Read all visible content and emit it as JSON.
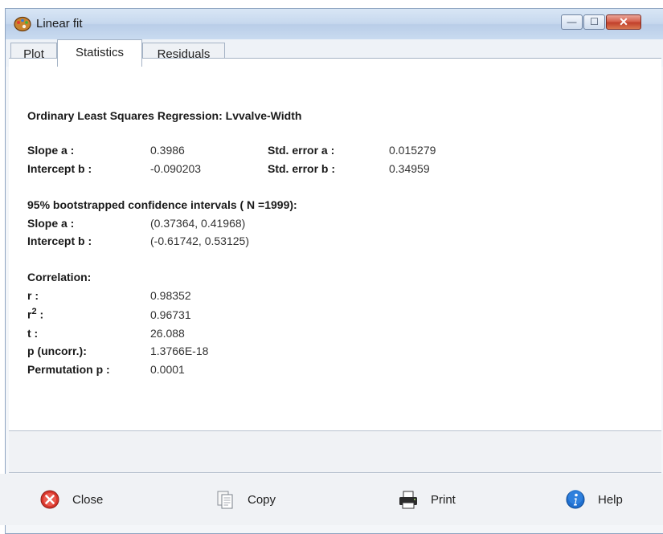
{
  "window": {
    "title": "Linear fit",
    "min_glyph": "—",
    "max_glyph": "☐",
    "close_glyph": "✕"
  },
  "tabs": [
    {
      "label": "Plot"
    },
    {
      "label": "Statistics"
    },
    {
      "label": "Residuals"
    }
  ],
  "stats": {
    "heading": "Ordinary  Least  Squares  Regression:  Lvvalve-Width",
    "slope_label": "Slope  a :",
    "slope_value": "0.3986",
    "se_a_label": "Std.  error  a :",
    "se_a_value": "0.015279",
    "intercept_label": "Intercept  b :",
    "intercept_value": "-0.090203",
    "se_b_label": "Std.  error  b :",
    "se_b_value": "0.34959",
    "ci_heading": "95%  bootstrapped  confidence  intervals  ( N =1999):",
    "ci_slope_label": "Slope  a :",
    "ci_slope_value": "(0.37364,  0.41968)",
    "ci_intercept_label": "Intercept  b :",
    "ci_intercept_value": "(-0.61742,  0.53125)",
    "corr_heading": "Correlation:",
    "r_label": "r :",
    "r_value": "0.98352",
    "r2_label_base": "r",
    "r2_label_sup": "2",
    "r2_label_colon": " :",
    "r2_value": "0.96731",
    "t_label": "t :",
    "t_value": "26.088",
    "p_label": "p   (uncorr.):",
    "p_value": "1.3766E-18",
    "perm_label": "Permutation  p :",
    "perm_value": "0.0001"
  },
  "buttons": {
    "close": "Close",
    "copy": "Copy",
    "print": "Print",
    "help": "Help"
  },
  "icons": {
    "app": "palette-icon",
    "close": "close-circle-icon",
    "copy": "copy-icon",
    "print": "printer-icon",
    "help": "info-icon"
  }
}
